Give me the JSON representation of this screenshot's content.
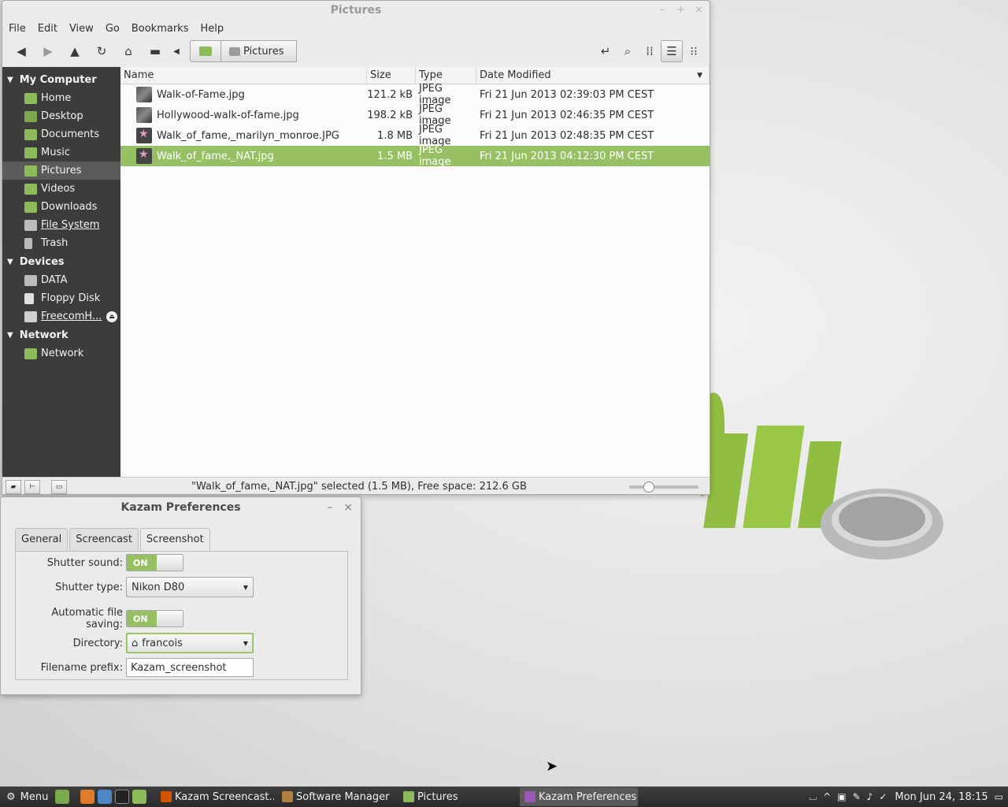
{
  "file_manager": {
    "title": "Pictures",
    "menu": [
      "File",
      "Edit",
      "View",
      "Go",
      "Bookmarks",
      "Help"
    ],
    "breadcrumb_current": "Pictures",
    "sidebar": {
      "sections": [
        {
          "heading": "My Computer",
          "items": [
            "Home",
            "Desktop",
            "Documents",
            "Music",
            "Pictures",
            "Videos",
            "Downloads",
            "File System",
            "Trash"
          ]
        },
        {
          "heading": "Devices",
          "items": [
            "DATA",
            "Floppy Disk",
            "FreecomH..."
          ]
        },
        {
          "heading": "Network",
          "items": [
            "Network"
          ]
        }
      ]
    },
    "columns": [
      "Name",
      "Size",
      "Type",
      "Date Modified"
    ],
    "files": [
      {
        "name": "Walk-of-Fame.jpg",
        "size": "121.2 kB",
        "type": "JPEG image",
        "date": "Fri 21 Jun 2013 02:39:03 PM CEST"
      },
      {
        "name": "Hollywood-walk-of-fame.jpg",
        "size": "198.2 kB",
        "type": "JPEG image",
        "date": "Fri 21 Jun 2013 02:46:35 PM CEST"
      },
      {
        "name": "Walk_of_fame,_marilyn_monroe.JPG",
        "size": "1.8 MB",
        "type": "JPEG image",
        "date": "Fri 21 Jun 2013 02:48:35 PM CEST"
      },
      {
        "name": "Walk_of_fame,_NAT.jpg",
        "size": "1.5 MB",
        "type": "JPEG image",
        "date": "Fri 21 Jun 2013 04:12:30 PM CEST"
      }
    ],
    "status": "\"Walk_of_fame,_NAT.jpg\" selected (1.5 MB), Free space: 212.6 GB",
    "zoom_level": 0.2
  },
  "kazam": {
    "title": "Kazam Preferences",
    "tabs": [
      "General",
      "Screencast",
      "Screenshot"
    ],
    "shutter_sound_label": "Shutter sound:",
    "shutter_sound_value": "ON",
    "shutter_type_label": "Shutter type:",
    "shutter_type_value": "Nikon D80",
    "auto_save_label": "Automatic file saving:",
    "auto_save_value": "ON",
    "directory_label": "Directory:",
    "directory_value": "francois",
    "prefix_label": "Filename prefix:",
    "prefix_value": "Kazam_screenshot"
  },
  "taskbar": {
    "menu_label": "Menu",
    "windows": [
      "Kazam Screencast...",
      "Software Manager",
      "Pictures",
      "Kazam Preferences"
    ],
    "clock": "Mon Jun 24, 18:15"
  },
  "colors": {
    "accent": "#97c065",
    "sidebar": "#3c3c3c"
  }
}
